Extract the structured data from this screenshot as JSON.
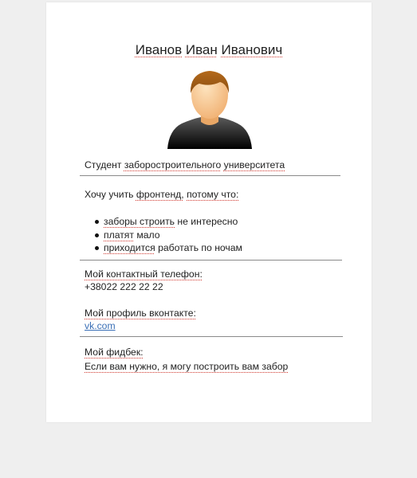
{
  "profile": {
    "name_parts": [
      "Иванов",
      "Иван",
      "Иванович"
    ],
    "status_parts": [
      "Студент",
      "заборостроительного",
      "университета"
    ],
    "intro_parts": [
      "Хочу учить",
      "фронтенд,",
      "потому что:"
    ],
    "likes": [
      {
        "a": "заборы строить",
        "b": " не интересно"
      },
      {
        "a": "платят",
        "b": " мало"
      },
      {
        "a": "приходится",
        "b": " работать по ночам"
      }
    ],
    "phone_label": "Мой контактный телефон:",
    "phone": "+38022 222 22 22",
    "vk_label": "Мой профиль вконтакте:",
    "vk_link": "vk.com",
    "feedback_label": "Мой фидбек:",
    "feedback_text_parts": [
      "Если вам нужно, я могу построить вам забор"
    ]
  },
  "colors": {
    "background": "#efefef",
    "card": "#ffffff",
    "link": "#3a6fb6",
    "spellcheck": "#d0372e"
  },
  "icons": {
    "avatar": "user-avatar-icon"
  }
}
